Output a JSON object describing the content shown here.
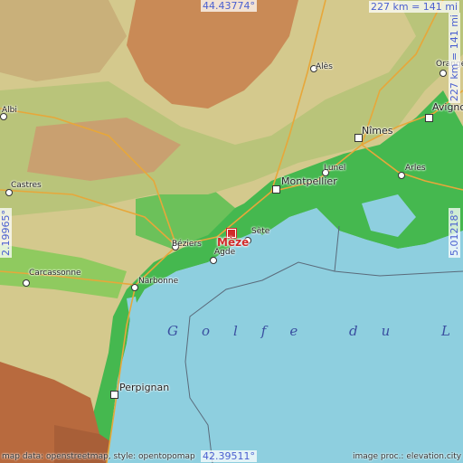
{
  "map": {
    "coordinates": {
      "north": "44.43774°",
      "south": "42.39511°",
      "west": "2.19965°",
      "east": "5.01218°",
      "scale": "227 km = 141 mi"
    },
    "marker": {
      "label": "Mèze",
      "color": "#d02a2a"
    },
    "cities": [
      "Montpellier",
      "Nîmes",
      "Béziers",
      "Perpignan",
      "Avignon",
      "Carcassonne",
      "Narbonne",
      "Sète",
      "Agde",
      "Arles",
      "Lunel",
      "Alès",
      "Castres",
      "Albi",
      "Orange"
    ],
    "sea_label": "Golfe du Lion",
    "credits": {
      "left": "map data: openstreetmap, style: opentopomap",
      "right": "image proc.: elevation.city"
    },
    "colors": {
      "sea": "#8ecfdf",
      "lowland": "#3fb24a",
      "hills": "#c9d48a",
      "mountains": "#c98a56",
      "marker": "#d02a2a",
      "coord_text": "#4a5fd0"
    }
  }
}
